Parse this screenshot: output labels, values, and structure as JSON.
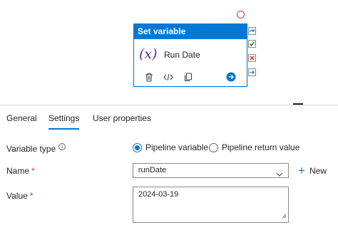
{
  "activity": {
    "header": "Set variable",
    "icon_symbol": "(x)",
    "name": "Run Date",
    "toolbar": [
      "delete-icon",
      "code-icon",
      "copy-icon",
      "go-arrow-icon"
    ],
    "side_icons": [
      "skip-icon",
      "success-check-icon",
      "failure-x-icon",
      "completion-arrow-icon"
    ]
  },
  "tabs": [
    {
      "label": "General",
      "active": false
    },
    {
      "label": "Settings",
      "active": true
    },
    {
      "label": "User properties",
      "active": false
    }
  ],
  "form": {
    "variable_type": {
      "label": "Variable type",
      "info_icon": "i",
      "options": [
        {
          "label": "Pipeline variable",
          "selected": true
        },
        {
          "label": "Pipeline return value",
          "selected": false
        }
      ]
    },
    "name": {
      "label": "Name",
      "required": "*",
      "value": "runDate",
      "new_label": "New",
      "new_icon": "+"
    },
    "value": {
      "label": "Value",
      "required": "*",
      "text": "2024-03-19"
    }
  },
  "colors": {
    "accent": "#0078d4",
    "required": "#c4314b",
    "success": "#107c10",
    "failure": "#d13438",
    "fx": "#5c2d91"
  }
}
